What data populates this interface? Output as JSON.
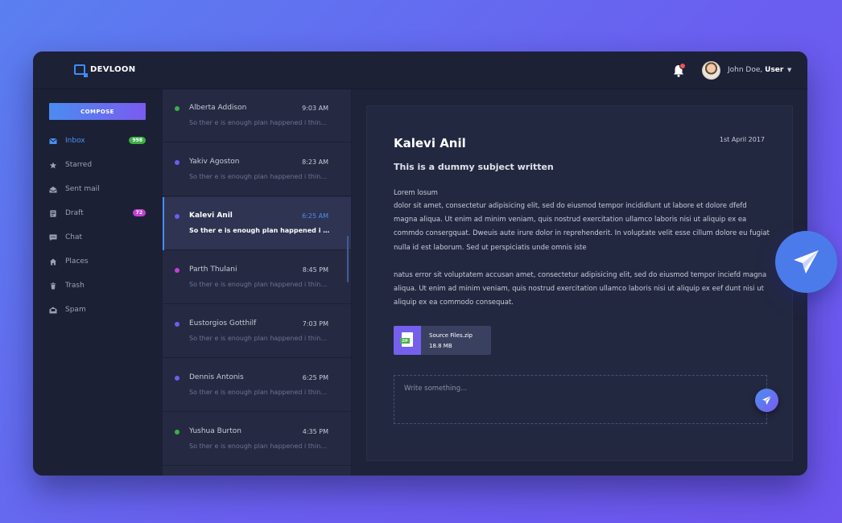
{
  "app": {
    "logo": "DEVLOON"
  },
  "header": {
    "notification_icon": "bell-icon",
    "user_name": "John Doe,",
    "user_role": "User"
  },
  "sidebar": {
    "compose_label": "COMPOSE",
    "items": [
      {
        "label": "Inbox",
        "icon": "envelope-icon",
        "badge": "998",
        "badge_color": "#3cb043",
        "active": true
      },
      {
        "label": "Starred",
        "icon": "star-icon"
      },
      {
        "label": "Sent mail",
        "icon": "sent-icon"
      },
      {
        "label": "Draft",
        "icon": "draft-icon",
        "badge": "72",
        "badge_color": "#c43fd4"
      },
      {
        "label": "Chat",
        "icon": "chat-icon"
      },
      {
        "label": "Places",
        "icon": "home-icon"
      },
      {
        "label": "Trash",
        "icon": "trash-icon"
      },
      {
        "label": "Spam",
        "icon": "spam-icon"
      }
    ]
  },
  "messages": [
    {
      "sender": "Alberta Addison",
      "time": "9:03 AM",
      "preview": "So ther e is enough plan happened i think...",
      "dot": "#3cb043"
    },
    {
      "sender": "Yakiv Agoston",
      "time": "8:23 AM",
      "preview": "So ther e is enough plan happened i think...",
      "dot": "#6a5ff0"
    },
    {
      "sender": "Kalevi Anil",
      "time": "6:25 AM",
      "preview": "So ther e is enough plan happened i think...",
      "dot": "#6a5ff0",
      "selected": true
    },
    {
      "sender": "Parth Thulani",
      "time": "8:45 PM",
      "preview": "So ther e is enough plan happened i think...",
      "dot": "#c43fd4"
    },
    {
      "sender": "Eustorgios Gotthilf",
      "time": "7:03 PM",
      "preview": "So ther e is enough plan happened i think...",
      "dot": "#6a5ff0"
    },
    {
      "sender": "Dennis Antonis",
      "time": "6:25 PM",
      "preview": "So ther e is enough plan happened i think...",
      "dot": "#6a5ff0"
    },
    {
      "sender": "Yushua Burton",
      "time": "4:35 PM",
      "preview": "So ther e is enough plan happened i think...",
      "dot": "#3cb043"
    }
  ],
  "reader": {
    "sender": "Kalevi Anil",
    "date": "1st April 2017",
    "subject": "This is a dummy subject written",
    "greeting": "Lorem losum",
    "paragraph1": "dolor sit amet, consectetur adipisicing elit, sed do eiusmod tempor incididlunt ut labore et dolore dfefd magna aliqua. Ut enim ad minim veniam, quis nostrud exercitation ullamco laboris nisi ut aliquip ex ea commdo consergquat. Dweuis aute irure dolor in reprehenderit. In voluptate velit esse cillum dolore eu fugiat nulla id est laborum. Sed ut perspiciatis unde omnis iste",
    "paragraph2": "natus error sit voluptatem accusan amet, consectetur adipisicing elit, sed do eiusmod tempor inciefd magna aliqua. Ut enim ad minim veniam, quis nostrud exercitation ullamco laboris nisi ut aliquip ex eef dunt nisi ut aliquip ex ea commodo consequat.",
    "attachment": {
      "name": "Source Files.zip",
      "size": "18.8 MB",
      "badge": "ZIP"
    },
    "reply_placeholder": "Write something..."
  },
  "colors": {
    "accent": "#4a8cf0",
    "accent2": "#7a5bf0",
    "panel": "#1c2035"
  }
}
